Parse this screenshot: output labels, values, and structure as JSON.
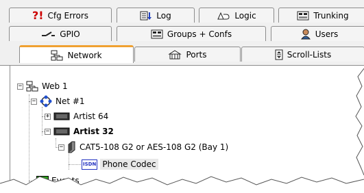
{
  "tabs": {
    "row1": [
      {
        "label": "Cfg Errors",
        "icon": "cfg-errors-icon"
      },
      {
        "label": "Log",
        "icon": "log-icon"
      },
      {
        "label": "Logic",
        "icon": "logic-icon"
      },
      {
        "label": "Trunking",
        "icon": "trunking-icon"
      }
    ],
    "row2": [
      {
        "label": "GPIO",
        "icon": "gpio-icon"
      },
      {
        "label": "Groups + Confs",
        "icon": "groups-icon"
      },
      {
        "label": "Users",
        "icon": "users-icon"
      }
    ],
    "row3": [
      {
        "label": "Network",
        "icon": "network-icon",
        "active": true
      },
      {
        "label": "Ports",
        "icon": "ports-icon"
      },
      {
        "label": "Scroll-Lists",
        "icon": "scroll-lists-icon"
      }
    ]
  },
  "tree": {
    "web": "Web 1",
    "net": "Net #1",
    "artist64": "Artist 64",
    "artist32": "Artist 32",
    "cat5": "CAT5-108 G2 or AES-108 G2 (Bay  1)",
    "isdn_badge": "ISDN",
    "phone_codec": "Phone Codec",
    "events_badge": "EV",
    "events": "Events"
  },
  "colors": {
    "accent": "#f0a030",
    "selection": "#e8e8e8",
    "error": "#cc0000",
    "isdn_blue": "#2030c0",
    "events_green": "#30a020"
  }
}
